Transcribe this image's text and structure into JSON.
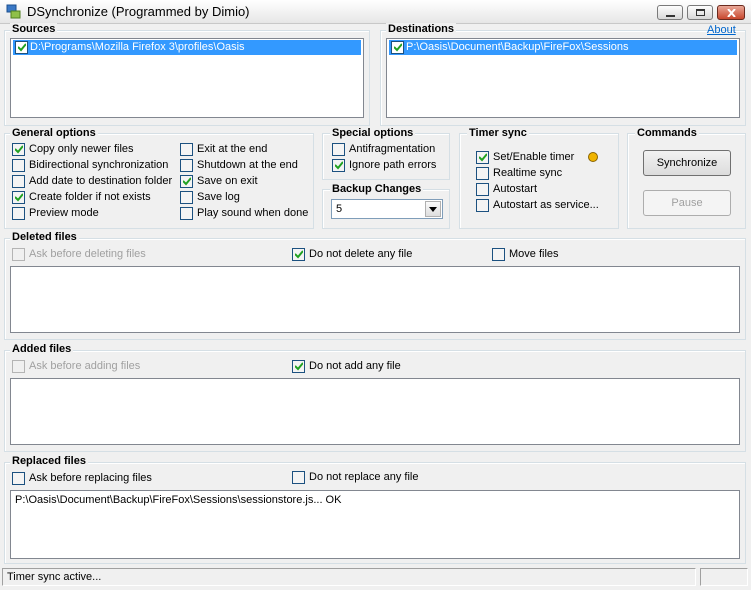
{
  "window": {
    "title": "DSynchronize (Programmed by Dimio)"
  },
  "about_link": "About",
  "sources": {
    "title": "Sources",
    "items": [
      {
        "label": "D:\\Programs\\Mozilla Firefox 3\\profiles\\Oasis",
        "checked": true
      }
    ]
  },
  "destinations": {
    "title": "Destinations",
    "items": [
      {
        "label": "P:\\Oasis\\Document\\Backup\\FireFox\\Sessions",
        "checked": true
      }
    ]
  },
  "general_options": {
    "title": "General options",
    "left": [
      {
        "label": "Copy only newer files",
        "checked": true
      },
      {
        "label": "Bidirectional synchronization",
        "checked": false
      },
      {
        "label": "Add date to destination folder",
        "checked": false
      },
      {
        "label": "Create folder if not exists",
        "checked": true
      },
      {
        "label": "Preview mode",
        "checked": false
      }
    ],
    "right": [
      {
        "label": "Exit at the end",
        "checked": false
      },
      {
        "label": "Shutdown at the end",
        "checked": false
      },
      {
        "label": "Save on exit",
        "checked": true
      },
      {
        "label": "Save log",
        "checked": false
      },
      {
        "label": "Play sound when done",
        "checked": false
      }
    ]
  },
  "special_options": {
    "title": "Special options",
    "items": [
      {
        "label": "Antifragmentation",
        "checked": false
      },
      {
        "label": "Ignore path errors",
        "checked": true
      }
    ]
  },
  "backup_changes": {
    "title": "Backup Changes",
    "value": "5"
  },
  "timer_sync": {
    "title": "Timer sync",
    "items": [
      {
        "label": "Set/Enable timer",
        "checked": true
      },
      {
        "label": "Realtime sync",
        "checked": false
      },
      {
        "label": "Autostart",
        "checked": false
      },
      {
        "label": "Autostart as service...",
        "checked": false
      }
    ],
    "indicator_color": "#f0b400"
  },
  "commands": {
    "title": "Commands",
    "synchronize_label": "Synchronize",
    "pause_label": "Pause"
  },
  "deleted_files": {
    "title": "Deleted files",
    "ask_label": "Ask before deleting files",
    "ask_checked": false,
    "no_op_label": "Do not delete any file",
    "no_op_checked": true,
    "move_label": "Move files",
    "move_checked": false,
    "entries": []
  },
  "added_files": {
    "title": "Added files",
    "ask_label": "Ask before adding files",
    "ask_checked": false,
    "no_op_label": "Do not add any file",
    "no_op_checked": true,
    "entries": []
  },
  "replaced_files": {
    "title": "Replaced files",
    "ask_label": "Ask before replacing files",
    "ask_checked": false,
    "no_op_label": "Do not replace any file",
    "no_op_checked": false,
    "entries": [
      "P:\\Oasis\\Document\\Backup\\FireFox\\Sessions\\sessionstore.js... OK"
    ]
  },
  "status": {
    "text": "Timer sync active..."
  },
  "colors": {
    "selection": "#3399ff",
    "check_mark": "#21a121",
    "link": "#0066cc"
  }
}
